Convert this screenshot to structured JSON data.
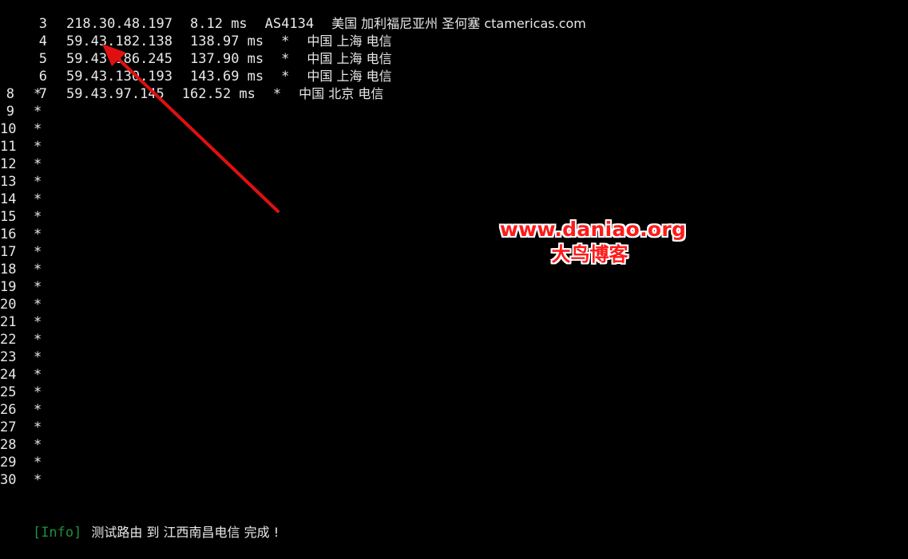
{
  "terminal": {
    "rows": [
      {
        "hop": "3",
        "ip": "218.30.48.197",
        "latency": "8.12 ms",
        "asn": "AS4134",
        "location": "美国 加利福尼亚州 圣何塞 ctamericas.com"
      },
      {
        "hop": "4",
        "ip": "59.43.182.138",
        "latency": "138.97 ms",
        "asn": "*",
        "location": "中国 上海 电信"
      },
      {
        "hop": "5",
        "ip": "59.43.186.245",
        "latency": "137.90 ms",
        "asn": "*",
        "location": "中国 上海 电信"
      },
      {
        "hop": "6",
        "ip": "59.43.130.193",
        "latency": "143.69 ms",
        "asn": "*",
        "location": "中国 上海 电信"
      },
      {
        "hop": "7",
        "ip": "59.43.97.145",
        "latency": "162.52 ms",
        "asn": "*",
        "location": "中国 北京 电信"
      }
    ],
    "timeouts": [
      "8",
      "9",
      "10",
      "11",
      "12",
      "13",
      "14",
      "15",
      "16",
      "17",
      "18",
      "19",
      "20",
      "21",
      "22",
      "23",
      "24",
      "25",
      "26",
      "27",
      "28",
      "29",
      "30"
    ],
    "timeout_marker": "*",
    "info": {
      "tag": "[Info]",
      "message": "测试路由 到 江西南昌电信 完成 !"
    }
  },
  "watermark": {
    "url": "www.daniao.org",
    "name": "大鸟博客"
  },
  "colors": {
    "background": "#000000",
    "text": "#e8e8e8",
    "info_tag": "#1e8f3a",
    "watermark": "#ff1a1a",
    "arrow": "#e01010"
  },
  "annotation": {
    "arrow_icon": "red-arrow-icon"
  }
}
